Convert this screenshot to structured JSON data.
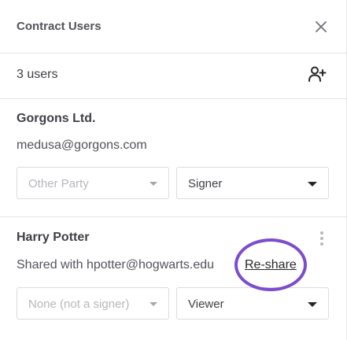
{
  "header": {
    "title": "Contract Users",
    "close_icon": "close-icon"
  },
  "summary": {
    "count_label": "3 users",
    "add_icon": "add-user-icon"
  },
  "users": [
    {
      "name": "Gorgons Ltd.",
      "email": "medusa@gorgons.com",
      "party_select": "Other Party",
      "role_select": "Signer"
    },
    {
      "name": "Harry Potter",
      "shared_text": "Shared with hpotter@hogwarts.edu",
      "reshare_label": "Re-share",
      "party_select": "None (not a signer)",
      "role_select": "Viewer"
    }
  ],
  "colors": {
    "highlight": "#7c4dcc"
  }
}
